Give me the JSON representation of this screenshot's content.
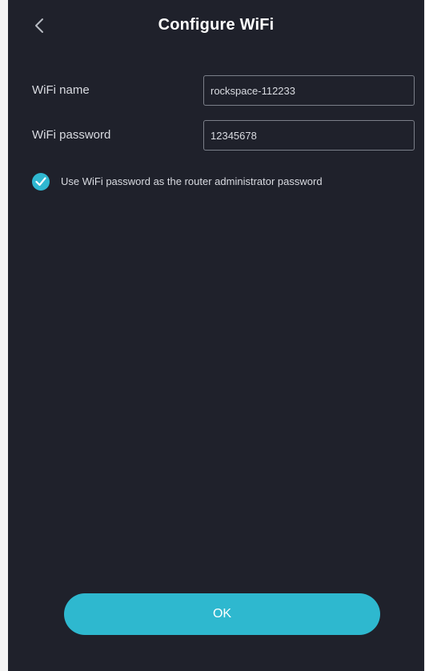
{
  "header": {
    "back_icon": "chevron-left-icon",
    "title": "Configure WiFi"
  },
  "form": {
    "wifi_name": {
      "label": "WiFi name",
      "value": "rockspace-112233"
    },
    "wifi_password": {
      "label": "WiFi password",
      "value": "12345678"
    }
  },
  "checkbox": {
    "checked": true,
    "icon": "checkmark-icon",
    "label": "Use WiFi password as the router administrator password"
  },
  "footer": {
    "ok_label": "OK"
  },
  "colors": {
    "background": "#1f212b",
    "accent": "#2eb8cf",
    "text": "#d9dbe1",
    "field_border": "#7b7f89"
  }
}
